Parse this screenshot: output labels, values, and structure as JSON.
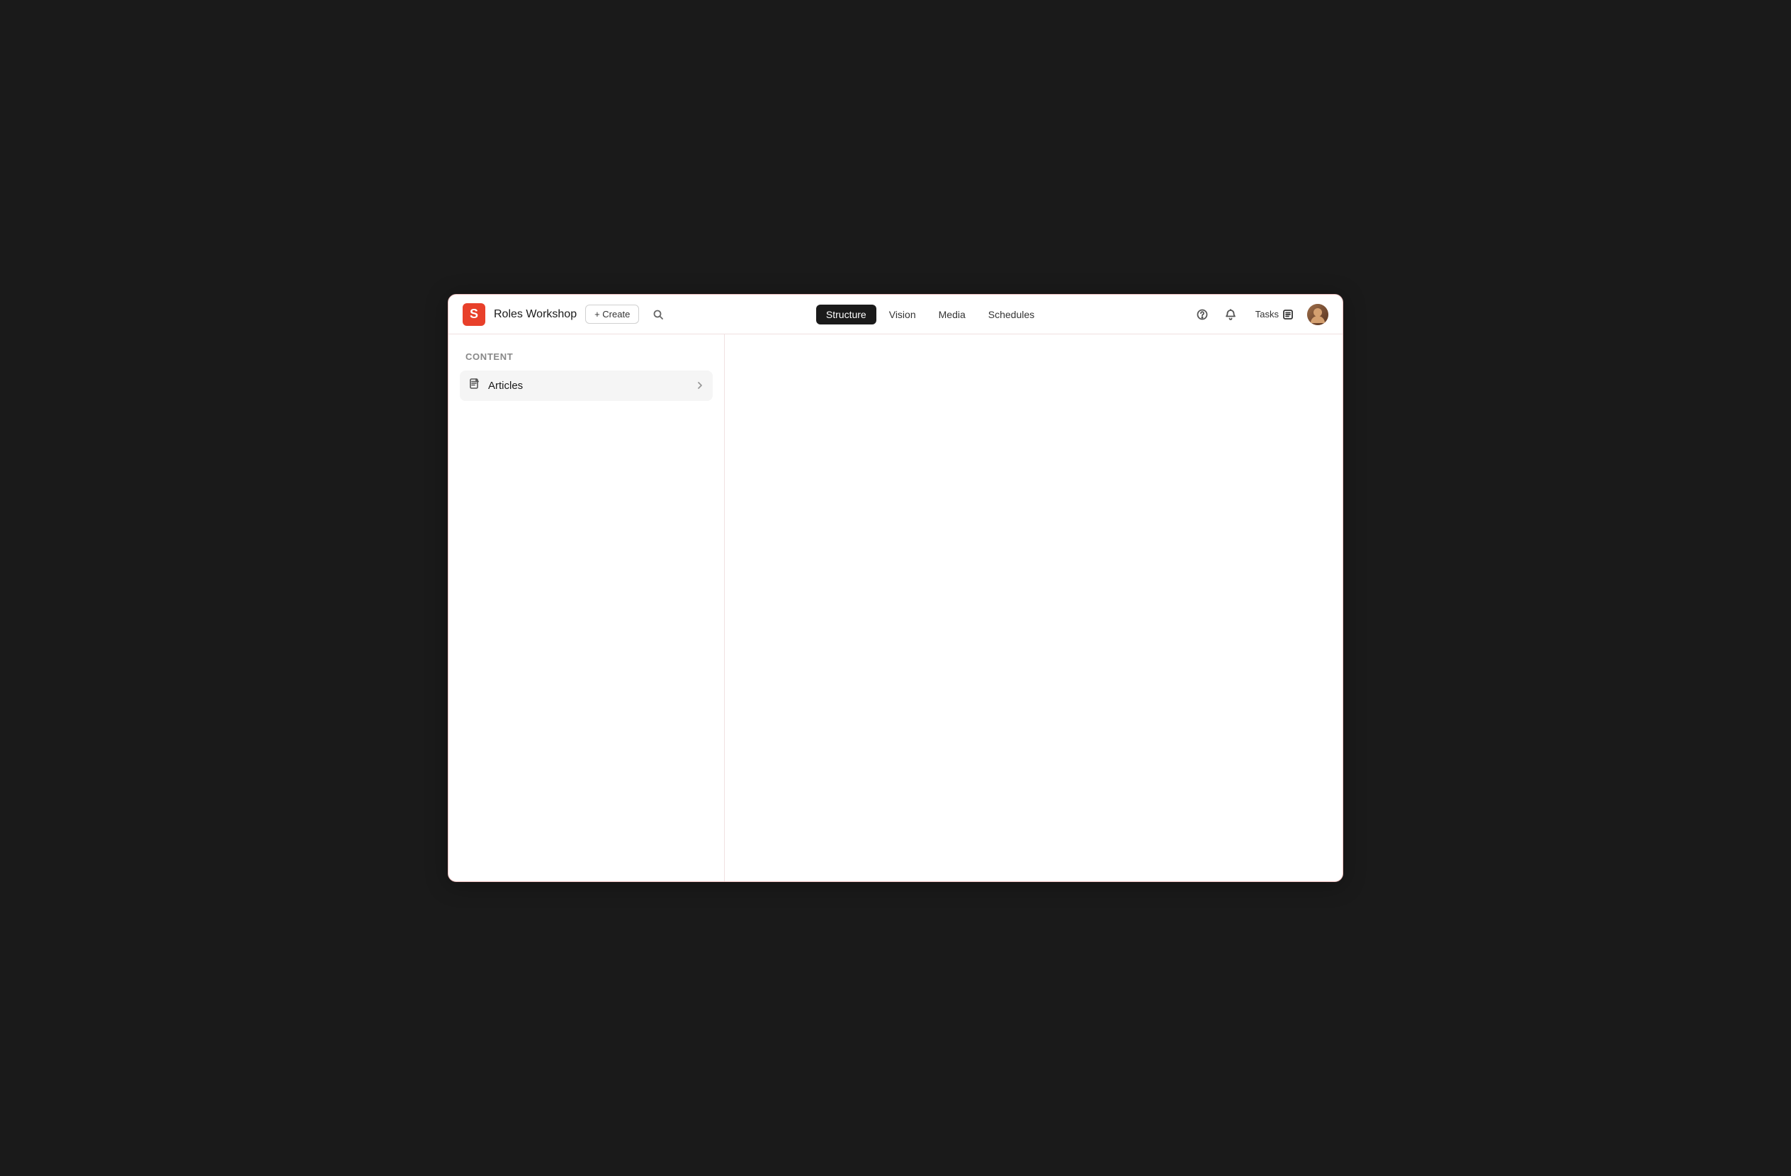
{
  "app": {
    "logo_letter": "S",
    "logo_color": "#e8402a"
  },
  "header": {
    "workspace_title": "Roles Workshop",
    "create_label": "+ Create",
    "tabs": [
      {
        "id": "structure",
        "label": "Structure",
        "active": true
      },
      {
        "id": "vision",
        "label": "Vision",
        "active": false
      },
      {
        "id": "media",
        "label": "Media",
        "active": false
      },
      {
        "id": "schedules",
        "label": "Schedules",
        "active": false
      }
    ],
    "tasks_label": "Tasks"
  },
  "sidebar": {
    "section_title": "Content",
    "items": [
      {
        "id": "articles",
        "label": "Articles",
        "icon": "document"
      }
    ]
  }
}
